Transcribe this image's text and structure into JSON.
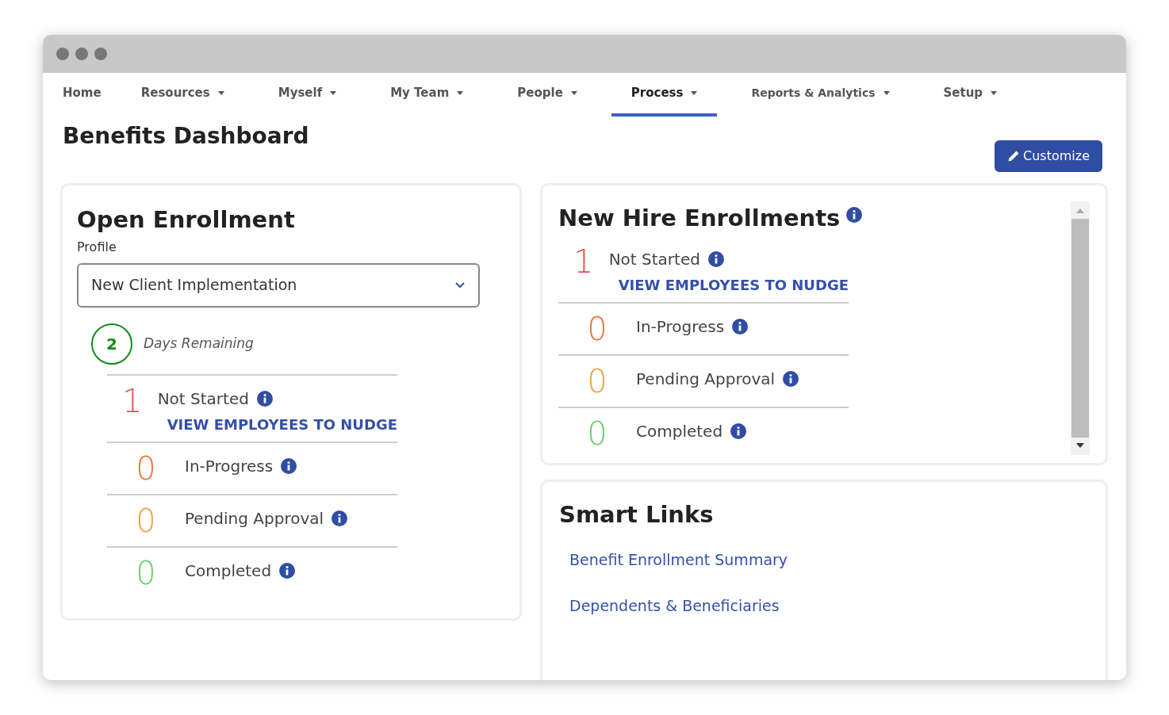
{
  "nav": [
    {
      "label": "Home",
      "dropdown": false,
      "selected": false
    },
    {
      "label": "Resources",
      "dropdown": true,
      "selected": false
    },
    {
      "label": "Myself",
      "dropdown": true,
      "selected": false
    },
    {
      "label": "My Team",
      "dropdown": true,
      "selected": false
    },
    {
      "label": "People",
      "dropdown": true,
      "selected": false
    },
    {
      "label": "Process",
      "dropdown": true,
      "selected": true
    },
    {
      "label": "Reports & Analytics",
      "dropdown": true,
      "selected": false
    },
    {
      "label": "Setup",
      "dropdown": true,
      "selected": false
    }
  ],
  "page_title": "Benefits Dashboard",
  "customize_button": "Customize",
  "open_enrollment": {
    "title": "Open Enrollment",
    "profile_label": "Profile",
    "profile_value": "New Client Implementation",
    "days_count": "2",
    "days_label": "Days Remaining",
    "statuses": [
      {
        "count": "1",
        "label": "Not Started",
        "color": "#e8534f",
        "link": "VIEW EMPLOYEES TO NUDGE"
      },
      {
        "count": "0",
        "label": "In-Progress",
        "color": "#f0773a"
      },
      {
        "count": "0",
        "label": "Pending Approval",
        "color": "#e9a450"
      },
      {
        "count": "0",
        "label": "Completed",
        "color": "#6fce6c"
      }
    ]
  },
  "new_hire": {
    "title": "New Hire Enrollments",
    "statuses": [
      {
        "count": "1",
        "label": "Not Started",
        "color": "#e8534f",
        "link": "VIEW EMPLOYEES TO NUDGE"
      },
      {
        "count": "0",
        "label": "In-Progress",
        "color": "#f0773a"
      },
      {
        "count": "0",
        "label": "Pending Approval",
        "color": "#e9a450"
      },
      {
        "count": "0",
        "label": "Completed",
        "color": "#6fce6c"
      }
    ]
  },
  "smart_links": {
    "title": "Smart Links",
    "links": [
      "Benefit Enrollment Summary",
      "Dependents & Beneficiaries"
    ]
  }
}
